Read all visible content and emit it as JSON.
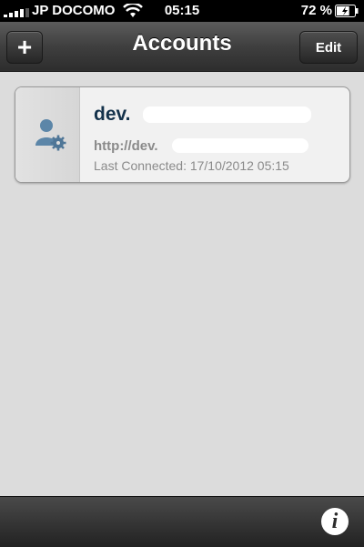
{
  "status_bar": {
    "carrier": "JP DOCOMO",
    "time": "05:15",
    "battery_percent": "72 %",
    "battery_level": 0.72,
    "signal_icon": "signal-bars-icon",
    "wifi_icon": "wifi-icon",
    "battery_icon": "battery-charging-icon"
  },
  "navbar": {
    "add_label": "+",
    "title": "Accounts",
    "edit_label": "Edit"
  },
  "accounts": [
    {
      "name": "dev.",
      "name_suffix": ".",
      "url": "http://dev.",
      "last_connected": "Last Connected: 17/10/2012 05:15",
      "icon": "user-settings-icon"
    }
  ],
  "toolbar": {
    "info_label": "i",
    "info_icon": "info-icon"
  },
  "colors": {
    "navbar": "#3f3f3f",
    "account_name": "#14324b",
    "secondary_text": "#8a8a8a",
    "background": "#dcdcdc"
  }
}
